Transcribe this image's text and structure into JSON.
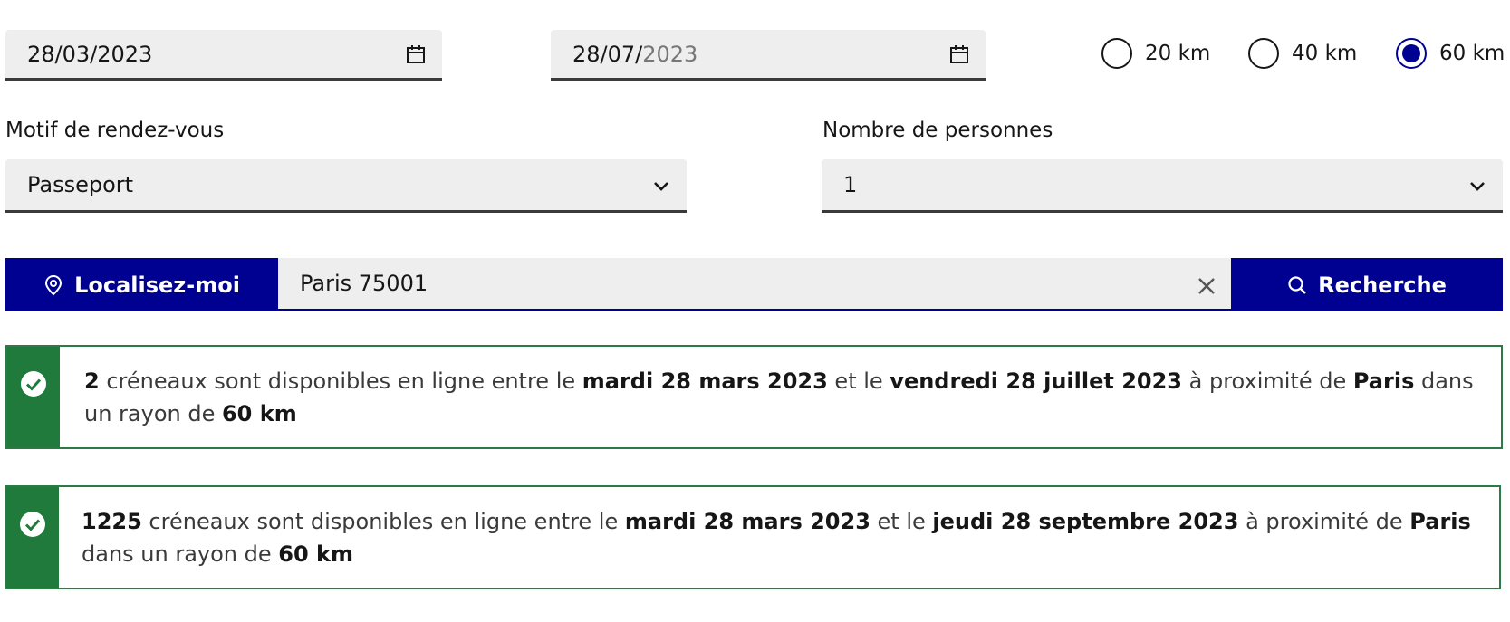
{
  "filters": {
    "start_date": {
      "value_main": "28/03/2023",
      "value_day_month": "",
      "value_year": ""
    },
    "end_date": {
      "value_day_month": "28/07/",
      "value_year": "2023"
    },
    "radius_options": [
      {
        "label": "20 km",
        "selected": false
      },
      {
        "label": "40 km",
        "selected": false
      },
      {
        "label": "60 km",
        "selected": true
      }
    ],
    "motif": {
      "label": "Motif de rendez-vous",
      "value": "Passeport"
    },
    "persons": {
      "label": "Nombre de personnes",
      "value": "1"
    }
  },
  "search": {
    "locate_label": "Localisez-moi",
    "location_value": "Paris 75001",
    "submit_label": "Recherche"
  },
  "results": [
    {
      "count": "2",
      "t1": " créneaux sont disponibles en ligne entre le ",
      "from": "mardi 28 mars 2023",
      "t2": " et le ",
      "to": "vendredi 28 juillet 2023",
      "t3": " à proximité de ",
      "city": "Paris",
      "t4": " dans un rayon de ",
      "radius": "60 km"
    },
    {
      "count": "1225",
      "t1": " créneaux sont disponibles en ligne entre le ",
      "from": "mardi 28 mars 2023",
      "t2": " et le ",
      "to": "jeudi 28 septembre 2023",
      "t3": " à proximité de ",
      "city": "Paris",
      "t4": " dans un rayon de ",
      "radius": "60 km"
    }
  ],
  "colors": {
    "primary_blue": "#000091",
    "success_green": "#1f7a3c",
    "field_bg": "#eeeeee"
  }
}
